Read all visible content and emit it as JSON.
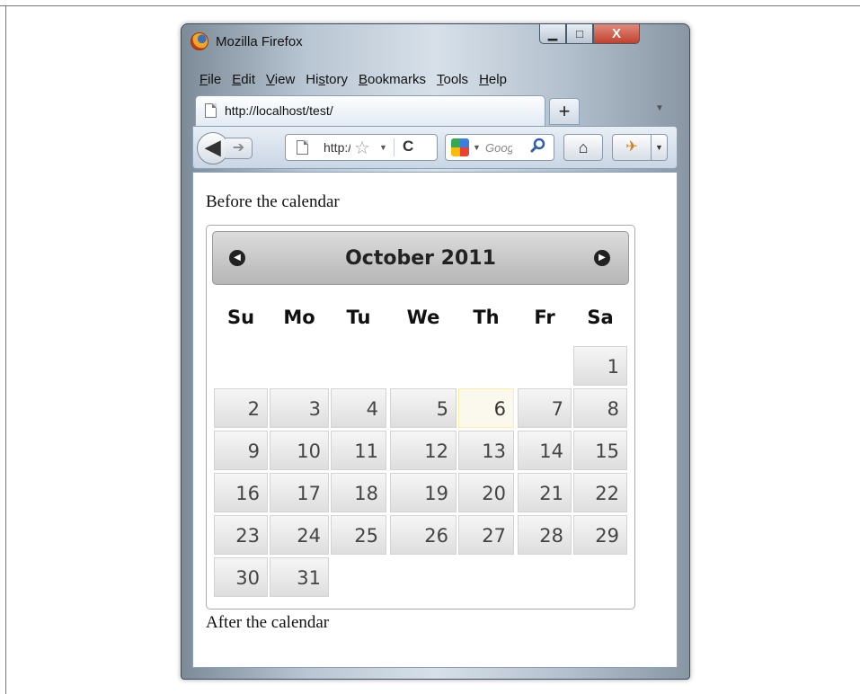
{
  "window": {
    "title": "Mozilla Firefox",
    "minimize_symbol": "▁",
    "maximize_symbol": "□",
    "close_symbol": "X"
  },
  "menu": [
    "File",
    "Edit",
    "View",
    "History",
    "Bookmarks",
    "Tools",
    "Help"
  ],
  "menu_access_keys": [
    "F",
    "E",
    "V",
    "s",
    "B",
    "T",
    "H"
  ],
  "tab": {
    "label": "http://localhost/test/",
    "new_tab_symbol": "+"
  },
  "navbar": {
    "url_text": "http://localhost/test/",
    "search_text": "Google",
    "back_symbol": "◀",
    "forward_symbol": "➔",
    "reload_symbol": "C",
    "home_symbol": "⌂"
  },
  "content": {
    "before_text": "Before the calendar",
    "after_text": "After the calendar"
  },
  "calendar": {
    "month_title": "October 2011",
    "weekdays": [
      "Su",
      "Mo",
      "Tu",
      "We",
      "Th",
      "Fr",
      "Sa"
    ],
    "first_weekday_index": 6,
    "days_in_month": 31,
    "highlighted_day": 6,
    "colors": {
      "highlight_bg": "#fbf9ee",
      "highlight_border": "#fcefa1",
      "header_bg": "#cccccc"
    }
  }
}
